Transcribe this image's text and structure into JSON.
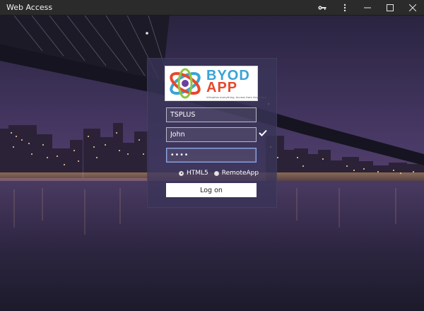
{
  "window": {
    "title": "Web Access"
  },
  "logo": {
    "line1": "BYOD",
    "line2": "APP",
    "tagline": "Virtualize everything. Access from Anywhere"
  },
  "form": {
    "server_value": "TSPLUS",
    "username_value": "John",
    "password_value": "••••",
    "mode_html5_label": "HTML5",
    "mode_remoteapp_label": "RemoteApp",
    "selected_mode": "HTML5",
    "logon_label": "Log on"
  },
  "icons": {
    "titlebar": [
      "key-icon",
      "more-vertical-icon",
      "minimize-icon",
      "maximize-icon",
      "close-icon"
    ],
    "username_status": "checkmark-icon"
  },
  "colors": {
    "titlebar": "#2b2b2b",
    "panel": "#3a3458",
    "logo_blue": "#3aa3d6",
    "logo_red": "#e8472c"
  }
}
